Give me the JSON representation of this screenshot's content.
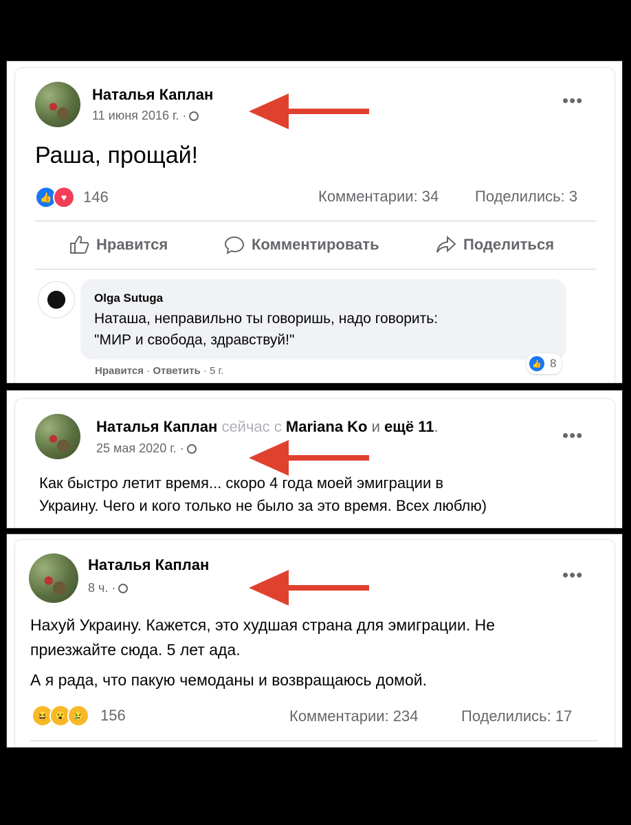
{
  "post1": {
    "author": "Наталья Каплан",
    "date": "11 июня 2016 г.",
    "text": "Раша, прощай!",
    "reactions_count": "146",
    "comments": "Комментарии: 34",
    "shares": "Поделились: 3",
    "actions": {
      "like": "Нравится",
      "comment": "Комментировать",
      "share": "Поделиться"
    },
    "comment": {
      "author": "Olga Sutuga",
      "line1": "Наташа, неправильно ты говоришь, надо говорить:",
      "line2": "\"МИР и свобода, здравствуй!\"",
      "like": "Нравится",
      "reply": "Ответить",
      "age": "5 г.",
      "reactions": "8"
    }
  },
  "post2": {
    "author": "Наталья Каплан",
    "with_prefix": "сейчас с",
    "tag1": "Mariana Ko",
    "and": "и",
    "tag2": "ещё 11",
    "date": "25 мая 2020 г.",
    "line1": "Как быстро летит время... скоро 4 года моей эмиграции в",
    "line2": "Украину. Чего и кого только не было за это время. Всех люблю)"
  },
  "post3": {
    "author": "Наталья Каплан",
    "date": "8 ч.",
    "line1": "Нахуй Украину. Кажется, это худшая страна для эмиграции. Не",
    "line2": "приезжайте сюда. 5 лет ада.",
    "line3": "А я рада, что пакую чемоданы и возвращаюсь домой.",
    "reactions_count": "156",
    "comments": "Комментарии: 234",
    "shares": "Поделились: 17"
  },
  "colors": {
    "arrow": "#e0412f",
    "like_blue": "#1877f2",
    "love_red": "#f33e58",
    "haha_yellow": "#f7b928"
  },
  "icons": [
    "globe-icon",
    "more-dots-icon",
    "like-icon",
    "comment-icon",
    "share-icon",
    "red-arrow"
  ]
}
